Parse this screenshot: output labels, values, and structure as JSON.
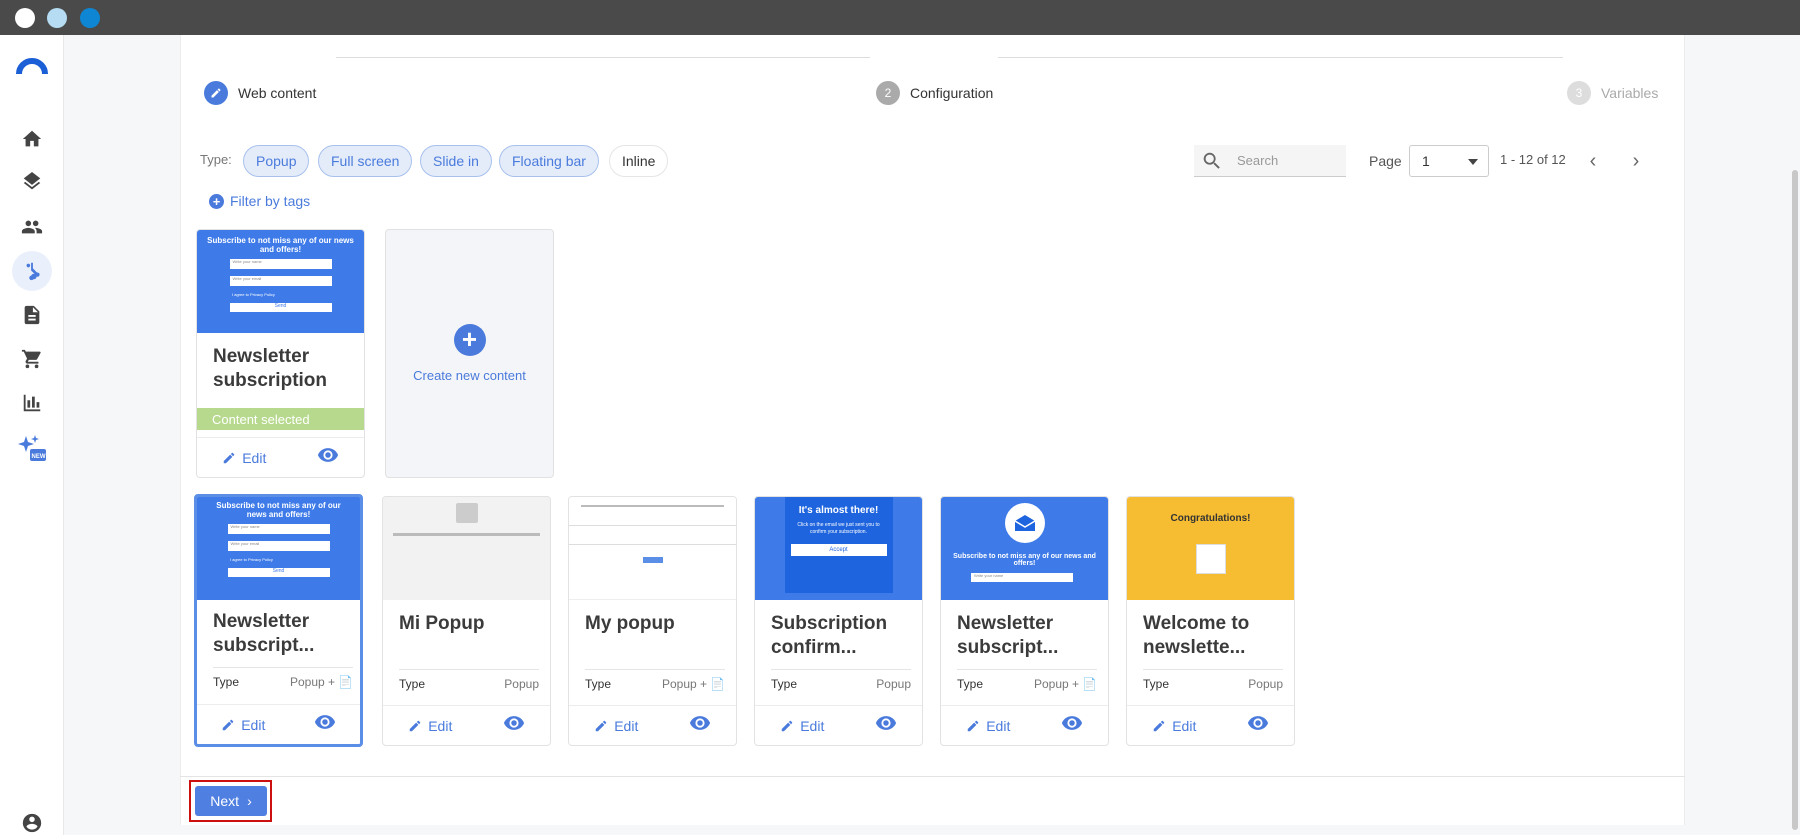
{
  "stepper": {
    "steps": [
      {
        "label": "Web content",
        "number": "",
        "state": "done"
      },
      {
        "label": "Configuration",
        "number": "2",
        "state": "current"
      },
      {
        "label": "Variables",
        "number": "3",
        "state": "pending"
      }
    ]
  },
  "filters": {
    "type_label": "Type:",
    "chips": [
      "Popup",
      "Full screen",
      "Slide in",
      "Floating bar",
      "Inline"
    ],
    "filter_by_tags": "Filter by tags"
  },
  "search": {
    "placeholder": "Search"
  },
  "pagination": {
    "page_label": "Page",
    "page_value": "1",
    "range": "1 - 12 of 12"
  },
  "selected_card": {
    "title": "Newsletter subscription [1]",
    "selected_label": "Content selected",
    "edit_label": "Edit"
  },
  "create_card": {
    "label": "Create new content"
  },
  "thumbnail_text": {
    "subscribe_heading": "Subscribe to not miss any of our news and offers!",
    "name_placeholder": "Write your name",
    "email_placeholder": "Write your email",
    "privacy": "I agree to Privacy Policy",
    "send": "Send",
    "almost_there": "It's almost there!",
    "almost_there_body": "Click on the email we just sent you to confirm your subscription.",
    "accept": "Accept",
    "congratulations": "Congratulations!"
  },
  "cards": [
    {
      "title": "Newsletter subscript...",
      "type_label": "Type",
      "type_value": "Popup +",
      "edit": "Edit"
    },
    {
      "title": "Mi Popup",
      "type_label": "Type",
      "type_value": "Popup",
      "edit": "Edit"
    },
    {
      "title": "My popup",
      "type_label": "Type",
      "type_value": "Popup +",
      "edit": "Edit"
    },
    {
      "title": "Subscription confirm...",
      "type_label": "Type",
      "type_value": "Popup",
      "edit": "Edit"
    },
    {
      "title": "Newsletter subscript...",
      "type_label": "Type",
      "type_value": "Popup +",
      "edit": "Edit"
    },
    {
      "title": "Welcome to newslette...",
      "type_label": "Type",
      "type_value": "Popup",
      "edit": "Edit"
    }
  ],
  "footer": {
    "next_label": "Next"
  },
  "colors": {
    "accent": "#4a7bdc",
    "selected_bar": "#b7d98e",
    "highlight": "#cc1010",
    "yellow_thumb": "#f6bd33"
  },
  "sidebar_icons": [
    "home-icon",
    "layers-icon",
    "people-icon",
    "flow-icon",
    "document-icon",
    "cart-icon",
    "chart-icon",
    "ai-sparkle-icon",
    "account-icon"
  ]
}
